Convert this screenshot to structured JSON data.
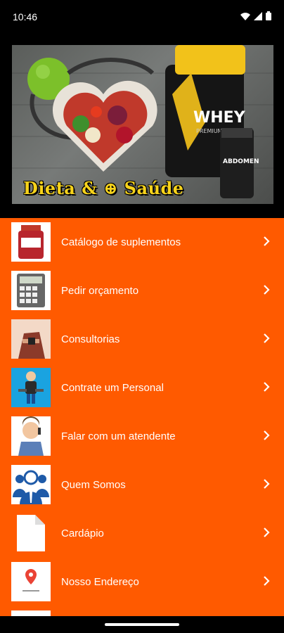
{
  "status_bar": {
    "time": "10:46"
  },
  "banner": {
    "title": "Dieta & ⊕ Saúde"
  },
  "menu": {
    "items": [
      {
        "label": "Catálogo de suplementos",
        "icon": "supplement-jar-icon"
      },
      {
        "label": "Pedir orçamento",
        "icon": "calculator-icon"
      },
      {
        "label": "Consultorias",
        "icon": "consultation-icon"
      },
      {
        "label": "Contrate um Personal",
        "icon": "personal-trainer-icon"
      },
      {
        "label": "Falar com um atendente",
        "icon": "support-agent-icon"
      },
      {
        "label": "Quem Somos",
        "icon": "team-icon"
      },
      {
        "label": "Cardápio",
        "icon": "document-icon"
      },
      {
        "label": "Nosso Endereço",
        "icon": "google-maps-icon"
      }
    ]
  },
  "colors": {
    "menu_bg": "#ff5a00",
    "banner_text": "#f7d31b"
  }
}
